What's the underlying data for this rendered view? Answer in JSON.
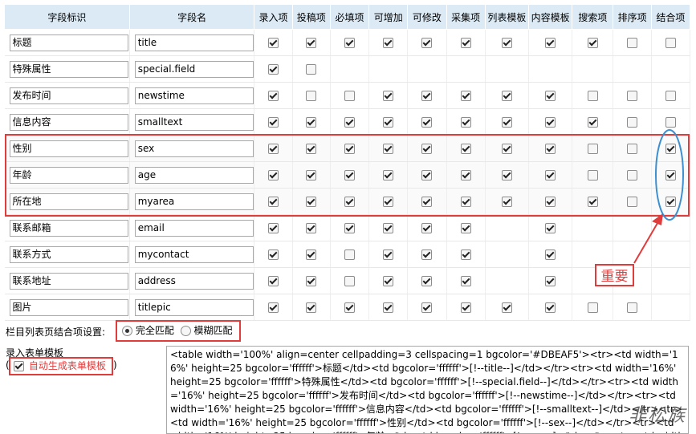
{
  "headers": [
    "字段标识",
    "字段名",
    "录入项",
    "投稿项",
    "必填项",
    "可增加",
    "可修改",
    "采集项",
    "列表模板",
    "内容模板",
    "搜索项",
    "排序项",
    "结合项"
  ],
  "rows": [
    {
      "label": "标题",
      "name": "title",
      "checks": [
        1,
        1,
        1,
        1,
        1,
        1,
        1,
        1,
        1,
        0,
        0
      ]
    },
    {
      "label": "特殊属性",
      "name": "special.field",
      "checks": [
        1,
        0,
        null,
        null,
        null,
        null,
        null,
        null,
        null,
        null,
        null
      ]
    },
    {
      "label": "发布时间",
      "name": "newstime",
      "checks": [
        1,
        0,
        0,
        1,
        1,
        1,
        1,
        1,
        0,
        0,
        0
      ]
    },
    {
      "label": "信息内容",
      "name": "smalltext",
      "checks": [
        1,
        1,
        1,
        1,
        1,
        1,
        1,
        1,
        1,
        0,
        0
      ]
    },
    {
      "label": "性别",
      "name": "sex",
      "checks": [
        1,
        1,
        1,
        1,
        1,
        1,
        1,
        1,
        0,
        0,
        1
      ]
    },
    {
      "label": "年龄",
      "name": "age",
      "checks": [
        1,
        1,
        1,
        1,
        1,
        1,
        1,
        1,
        0,
        0,
        1
      ]
    },
    {
      "label": "所在地",
      "name": "myarea",
      "checks": [
        1,
        1,
        1,
        1,
        1,
        1,
        1,
        1,
        1,
        0,
        1
      ]
    },
    {
      "label": "联系邮箱",
      "name": "email",
      "checks": [
        1,
        1,
        1,
        1,
        1,
        1,
        null,
        1,
        null,
        null,
        null
      ]
    },
    {
      "label": "联系方式",
      "name": "mycontact",
      "checks": [
        1,
        1,
        0,
        1,
        1,
        1,
        null,
        1,
        null,
        null,
        null
      ]
    },
    {
      "label": "联系地址",
      "name": "address",
      "checks": [
        1,
        1,
        0,
        1,
        1,
        1,
        null,
        1,
        null,
        null,
        null
      ]
    },
    {
      "label": "图片",
      "name": "titlepic",
      "checks": [
        1,
        1,
        1,
        1,
        1,
        1,
        1,
        1,
        0,
        0,
        null
      ]
    }
  ],
  "list_match": {
    "label": "栏目列表页结合项设置:",
    "exact": "完全匹配",
    "fuzzy": "模糊匹配"
  },
  "form_template": {
    "label": "录入表单模板",
    "auto": "自动生成表单模板",
    "paren_open": "(",
    "paren_close": ")"
  },
  "code": "<table width='100%' align=center cellpadding=3 cellspacing=1 bgcolor='#DBEAF5'><tr><td width='16%' height=25 bgcolor='ffffff'>标题</td><td bgcolor='ffffff'>[!--title--]</td></tr><tr><td width='16%' height=25 bgcolor='ffffff'>特殊属性</td><td bgcolor='ffffff'>[!--special.field--]</td></tr><tr><td width='16%' height=25 bgcolor='ffffff'>发布时间</td><td bgcolor='ffffff'>[!--newstime--]</td></tr><tr><td width='16%' height=25 bgcolor='ffffff'>信息内容</td><td bgcolor='ffffff'>[!--smalltext--]</td></tr><tr><td width='16%' height=25 bgcolor='ffffff'>性别</td><td bgcolor='ffffff'>[!--sex--]</td></tr><tr><td width='16%' height=25 bgcolor='ffffff'>年龄</td><td bgcolor='ffffff'>[!--age--]</td></tr><tr><td width='16%' height=25 bgcolor='ffffff'>所在地</td><td bgcolor='ffffff'>[!--myarea--]</td></tr>",
  "annotation": {
    "label": "重要"
  },
  "watermark": "非松族",
  "colors": {
    "header_bg": "#DBEAF5",
    "annotation_red": "#E03C3C",
    "annotation_blue": "#3C8FD0"
  }
}
